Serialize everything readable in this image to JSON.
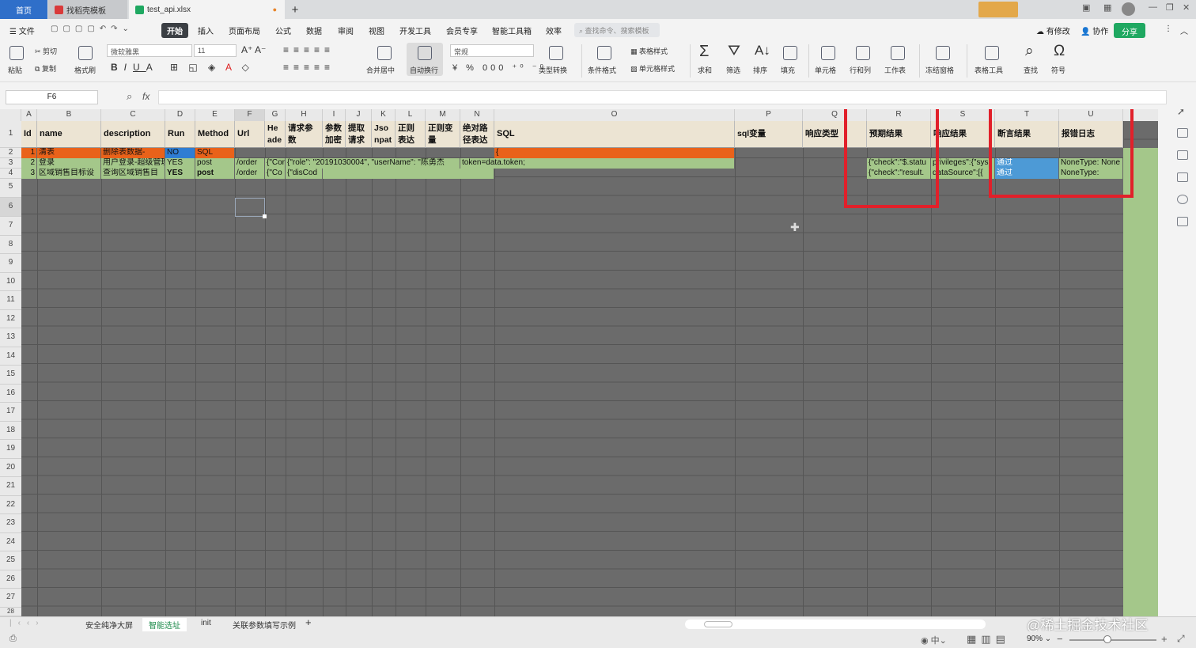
{
  "tabs": {
    "home": "首页",
    "template": "找稻壳模板",
    "file": "test_api.xlsx",
    "plus": "+"
  },
  "menu": [
    "文件",
    "开始",
    "插入",
    "页面布局",
    "公式",
    "数据",
    "审阅",
    "视图",
    "开发工具",
    "会员专享",
    "智能工具箱",
    "效率"
  ],
  "menu_search": "查找命令、搜索模板",
  "menu_right": {
    "modified": "有修改",
    "collab": "协作",
    "share": "分享"
  },
  "ribbon": {
    "paste": "粘贴",
    "cut": "剪切",
    "copy": "复制",
    "format_painter": "格式刷",
    "font_name": "微软雅黑",
    "font_size": "11",
    "merge": "合并居中",
    "wrap": "自动换行",
    "number_format": "常规",
    "type_convert": "类型转换",
    "cond_format": "条件格式",
    "table_style": "表格样式",
    "cell_style": "单元格样式",
    "sum": "求和",
    "filter": "筛选",
    "sort": "排序",
    "fill": "填充",
    "cell": "单元格",
    "rowcol": "行和列",
    "worksheet": "工作表",
    "freeze": "冻结窗格",
    "table_tools": "表格工具",
    "find": "查找",
    "symbol": "符号"
  },
  "formula": {
    "cell_ref": "F6",
    "fx": "fx",
    "value": ""
  },
  "columns": [
    "A",
    "B",
    "C",
    "D",
    "E",
    "F",
    "G",
    "H",
    "I",
    "J",
    "K",
    "L",
    "M",
    "N",
    "O",
    "P",
    "Q",
    "R",
    "S",
    "T",
    "U"
  ],
  "rows": [
    "1",
    "2",
    "3",
    "4",
    "5",
    "6",
    "7",
    "8",
    "9",
    "10",
    "11",
    "12",
    "13",
    "14",
    "15",
    "16",
    "17",
    "18",
    "19",
    "20",
    "21",
    "22",
    "23",
    "24",
    "25",
    "26",
    "27",
    "28"
  ],
  "headers": {
    "A": "Id",
    "B": "name",
    "C": "description",
    "D": "Run",
    "E": "Method",
    "F": "Url",
    "G": "Headers",
    "H": "请求参数",
    "I": "参数加密",
    "J": "提取请求",
    "K": "Jsonpath",
    "L": "正则表达",
    "M": "正则变量",
    "N": "绝对路径表达",
    "O": "SQL",
    "P": "sql变量",
    "Q": "响应类型",
    "R": "预期结果",
    "S": "响应结果",
    "T": "断言结果",
    "U": "报错日志"
  },
  "data_rows": [
    {
      "A": "1",
      "B": "清表",
      "C": "删除表数据-",
      "D": "NO",
      "E": "SQL",
      "F": "",
      "G": "",
      "H": "",
      "N": "",
      "O": "{",
      "R": "",
      "S": "",
      "T": "",
      "U": ""
    },
    {
      "A": "2",
      "B": "登录",
      "C": "用户登录-超级管理",
      "D": "YES",
      "E": "post",
      "F": "/order",
      "G": "{\"Con",
      "H": "{\"role\": \"20191030004\", \"userName\": \"陈勇杰",
      "N": "token=data.token;",
      "O": "",
      "R": "{\"check\":\"$.statu",
      "S": "privileges\":{\"sys",
      "T": "通过",
      "U": "NoneType: None"
    },
    {
      "A": "3",
      "B": "区域销售目标设",
      "C": "查询区域销售目",
      "D": "YES",
      "E": "post",
      "F": "/order",
      "G": "{\"Co",
      "H": "{\"disCod",
      "N": "",
      "O": "",
      "R": "{\"check\":\"result.",
      "S": "dataSource\":[{",
      "T": "通过",
      "U": "NoneType:"
    }
  ],
  "sheets": [
    "安全纯净大屏",
    "智能选址",
    "init",
    "关联参数填写示例"
  ],
  "status": {
    "zoom": "90%"
  },
  "watermark": "@稀土掘金技术社区"
}
